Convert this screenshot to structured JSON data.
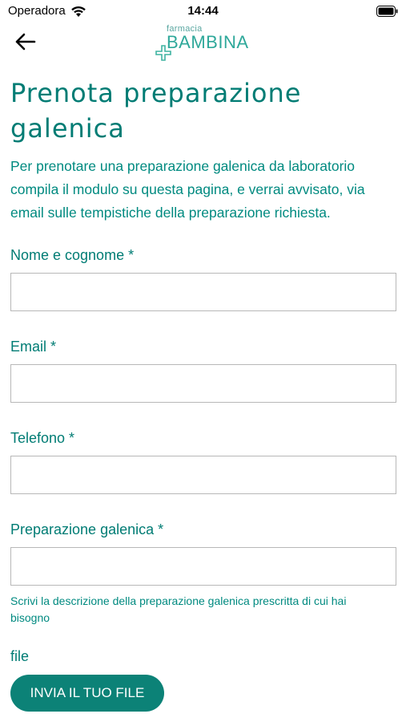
{
  "status_bar": {
    "carrier": "Operadora",
    "time": "14:44"
  },
  "header": {
    "logo_small": "farmacia",
    "logo_big": "BAMBINA"
  },
  "page": {
    "title": "Prenota preparazione galenica",
    "intro": "Per prenotare una preparazione galenica da laboratorio compila il modulo su questa pagina, e verrai avvisato, via email sulle tempistiche della preparazione richiesta."
  },
  "form": {
    "name_label": "Nome e cognome *",
    "email_label": "Email *",
    "phone_label": "Telefono *",
    "preparation_label": "Preparazione galenica *",
    "preparation_hint": "Scrivi la descrizione della preparazione galenica prescritta di cui hai bisogno",
    "file_label": "file",
    "upload_button": "INVIA IL TUO FILE"
  },
  "colors": {
    "brand": "#007c74",
    "button": "#0c8277",
    "logo": "#2ea89a"
  }
}
